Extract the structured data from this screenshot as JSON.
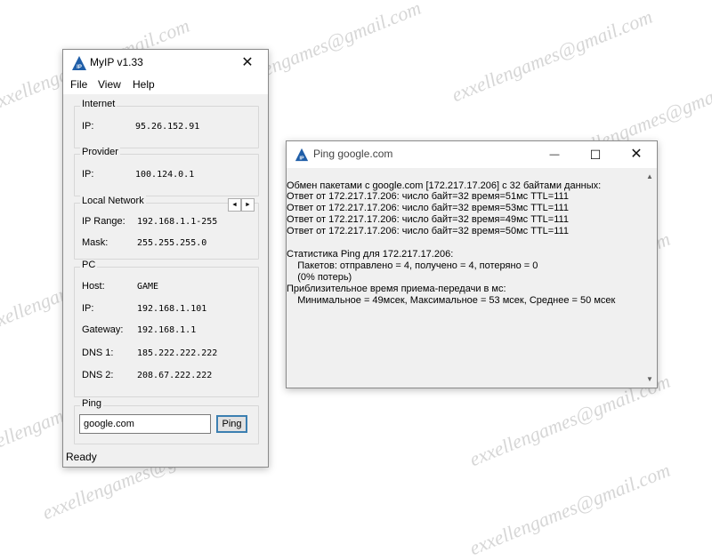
{
  "watermark": "exxellengames@gmail.com",
  "myip": {
    "title": "MyIP v1.33",
    "logo_text": "IP",
    "close_glyph": "✕",
    "menu": [
      "File",
      "View",
      "Help"
    ],
    "internet": {
      "title": "Internet",
      "ip_label": "IP:",
      "ip": "95.26.152.91"
    },
    "provider": {
      "title": "Provider",
      "ip_label": "IP:",
      "ip": "100.124.0.1"
    },
    "local_network": {
      "title": "Local Network",
      "range_label": "IP Range:",
      "range": "192.168.1.1-255",
      "mask_label": "Mask:",
      "mask": "255.255.255.0",
      "prev_glyph": "◄",
      "next_glyph": "►"
    },
    "pc": {
      "title": "PC",
      "host_label": "Host:",
      "host": "GAME",
      "ip_label": "IP:",
      "ip": "192.168.1.101",
      "gateway_label": "Gateway:",
      "gateway": "192.168.1.1",
      "dns1_label": "DNS 1:",
      "dns1": "185.222.222.222",
      "dns2_label": "DNS 2:",
      "dns2": "208.67.222.222"
    },
    "ping": {
      "title": "Ping",
      "input_value": "google.com",
      "button": "Ping"
    },
    "status": "Ready"
  },
  "ping_window": {
    "title": "Ping google.com",
    "minimize_glyph": "—",
    "maximize_glyph": "☐",
    "close_glyph": "✕",
    "scroll_up_glyph": "▲",
    "scroll_down_glyph": "▼",
    "lines": [
      "Обмен пакетами с google.com [172.217.17.206] с 32 байтами данных:",
      "Ответ от 172.217.17.206: число байт=32 время=51мс TTL=111",
      "Ответ от 172.217.17.206: число байт=32 время=53мс TTL=111",
      "Ответ от 172.217.17.206: число байт=32 время=49мс TTL=111",
      "Ответ от 172.217.17.206: число байт=32 время=50мс TTL=111",
      "",
      "Статистика Ping для 172.217.17.206:",
      "    Пакетов: отправлено = 4, получено = 4, потеряно = 0",
      "    (0% потерь)",
      "Приблизительное время приема-передачи в мс:",
      "    Минимальное = 49мсек, Максимальное = 53 мсек, Среднее = 50 мсек"
    ]
  }
}
